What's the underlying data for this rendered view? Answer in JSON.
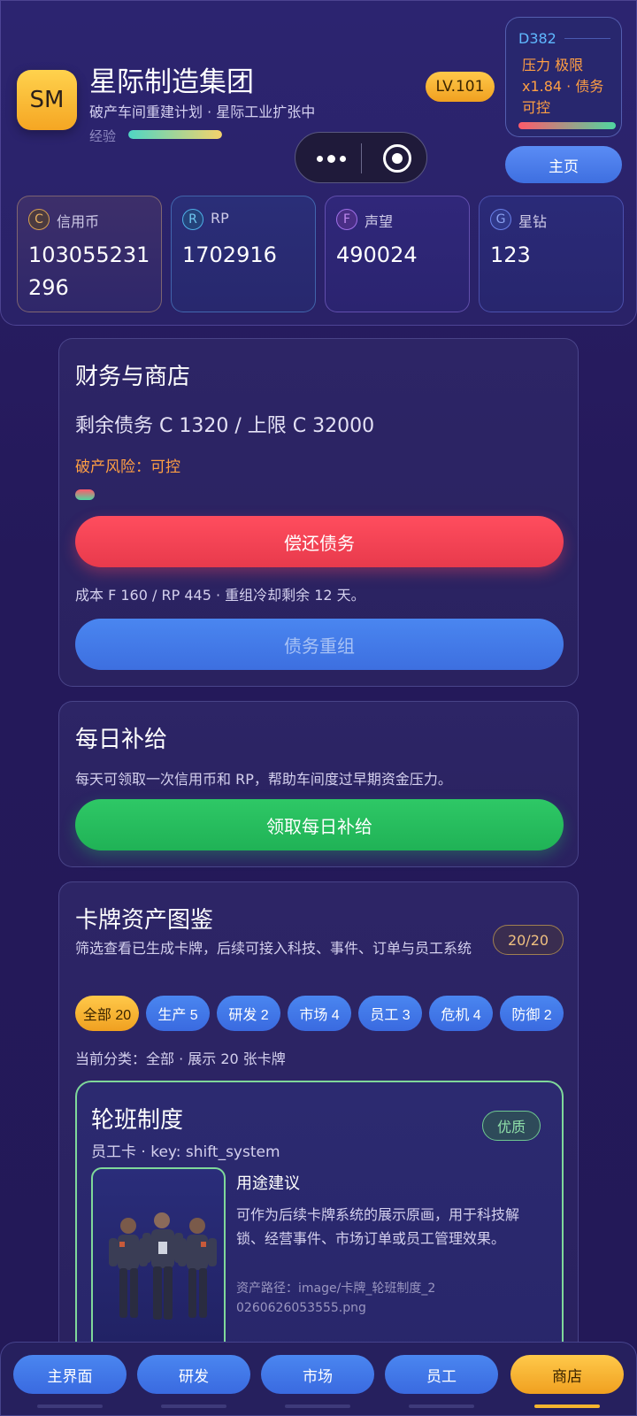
{
  "header": {
    "logo_text": "SM",
    "company_name": "星际制造集团",
    "subtitle": "破产车间重建计划 · 星际工业扩张中",
    "exp_label": "经验",
    "exp_progress_percent": 100,
    "level": "LV.101",
    "day": "D382",
    "pressure_text": "压力 极限 x1.84 · 债务 可控",
    "home_button": "主页"
  },
  "resources": [
    {
      "icon": "C",
      "name": "信用币",
      "value": "103055231296"
    },
    {
      "icon": "R",
      "name": "RP",
      "value": "1702916"
    },
    {
      "icon": "F",
      "name": "声望",
      "value": "490024"
    },
    {
      "icon": "G",
      "name": "星钻",
      "value": "123"
    }
  ],
  "finance": {
    "title": "财务与商店",
    "debt_text": "剩余债务 C 1320 / 上限 C 32000",
    "risk_text": "破产风险：可控",
    "repay_button": "偿还债务",
    "cost_text": "成本 F 160 / RP 445 · 重组冷却剩余 12 天。",
    "restructure_button": "债务重组"
  },
  "daily": {
    "title": "每日补给",
    "desc": "每天可领取一次信用币和 RP，帮助车间度过早期资金压力。",
    "claim_button": "领取每日补给"
  },
  "gallery": {
    "title": "卡牌资产图鉴",
    "subtitle": "筛选查看已生成卡牌，后续可接入科技、事件、订单与员工系统",
    "count": "20/20",
    "filters": [
      "全部 20",
      "生产 5",
      "研发 2",
      "市场 4",
      "员工 3",
      "危机 4",
      "防御 2"
    ],
    "current_filter_text": "当前分类：全部 · 展示 20 张卡牌",
    "card": {
      "name": "轮班制度",
      "key_text": "员工卡 · key: shift_system",
      "quality": "优质",
      "usage_title": "用途建议",
      "usage_desc": "可作为后续卡牌系统的展示原画，用于科技解锁、经营事件、市场订单或员工管理效果。",
      "path": "资产路径：image/卡牌_轮班制度_20260626053555.png"
    }
  },
  "nav": [
    "主界面",
    "研发",
    "市场",
    "员工",
    "商店"
  ],
  "colors": {
    "accent_gold": "#f5b52f",
    "primary_blue": "#3e6fe0",
    "danger_red": "#ff4d5e",
    "success_green": "#2ec866",
    "warning_orange": "#ff9f43"
  }
}
